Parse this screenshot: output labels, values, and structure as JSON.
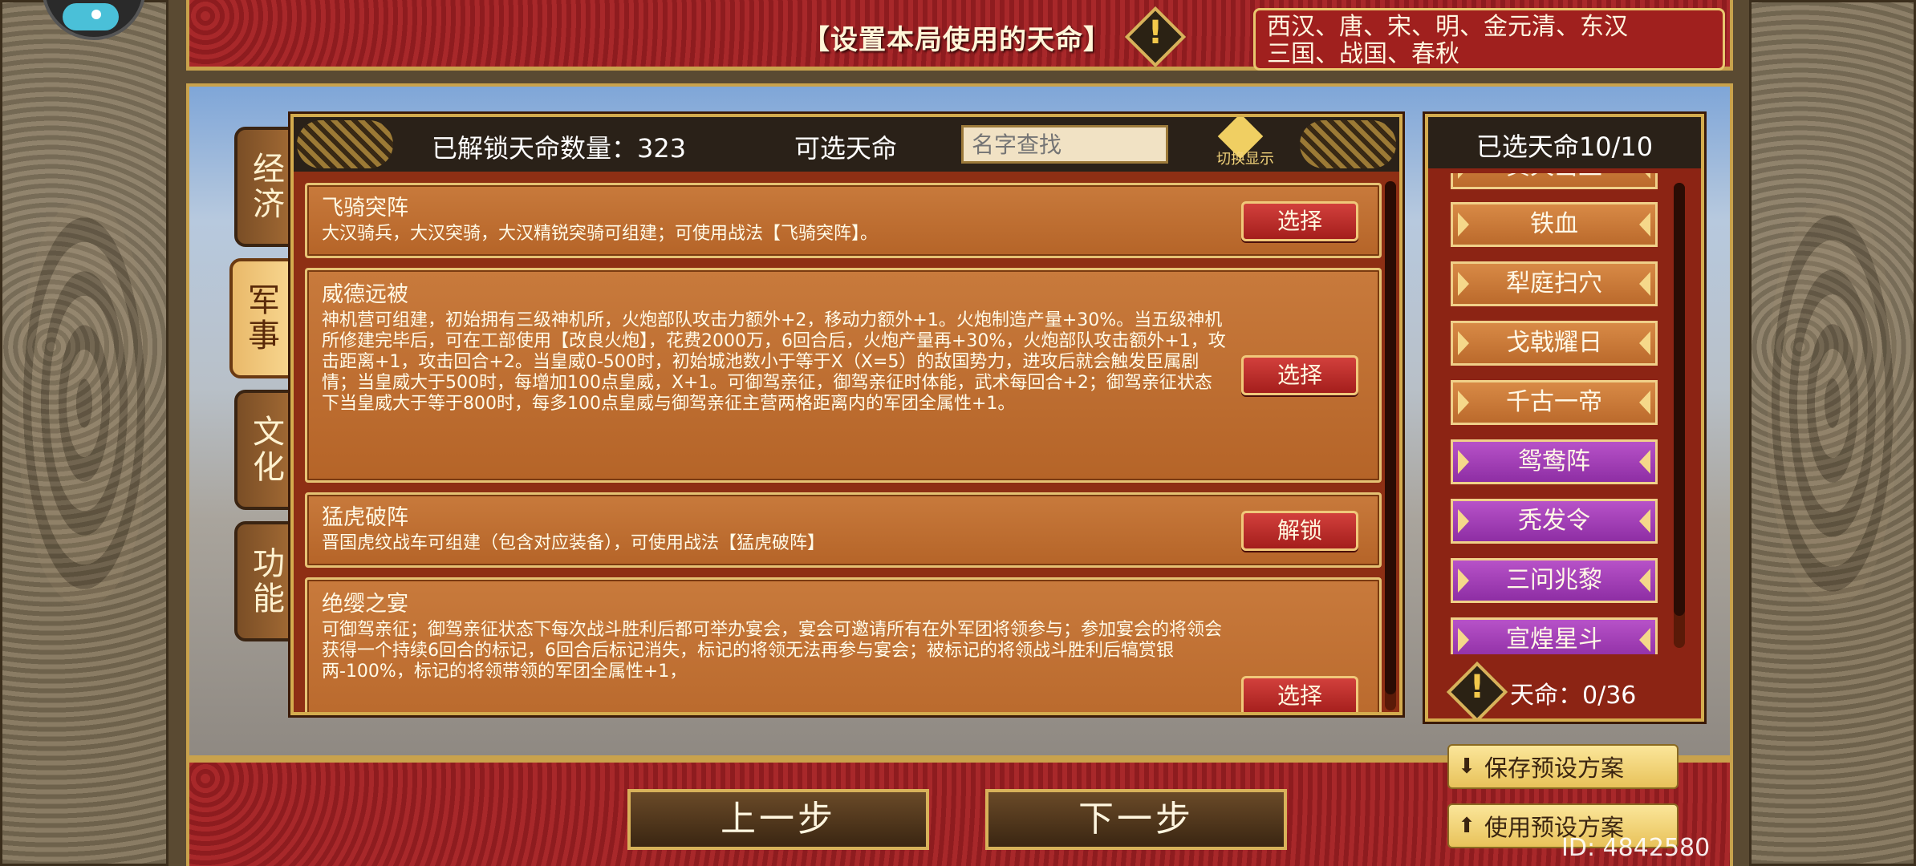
{
  "banner": {
    "title": "【设置本局使用的天命】",
    "warn_symbol": "!",
    "dynasties_line1": "西汉、唐、宋、明、金元清、东汉",
    "dynasties_line2": "三国、战国、春秋"
  },
  "tabs": [
    {
      "label": "经济",
      "active": false
    },
    {
      "label": "军事",
      "active": true
    },
    {
      "label": "文化",
      "active": false
    },
    {
      "label": "功能",
      "active": false
    }
  ],
  "list_panel": {
    "unlocked_label": "已解锁天命数量：323",
    "selectable_label": "可选天命",
    "search_placeholder": "名字查找",
    "toggle_label": "切换显示"
  },
  "cards": [
    {
      "title": "飞骑突阵",
      "desc": "大汉骑兵，大汉突骑，大汉精锐突骑可组建；可使用战法【飞骑突阵】。",
      "button": "选择"
    },
    {
      "title": "威德远被",
      "desc": "神机营可组建，初始拥有三级神机所，火炮部队攻击力额外+2，移动力额外+1。火炮制造产量+30%。当五级神机所修建完毕后，可在工部使用【改良火炮】，花费2000万，6回合后，火炮产量再+30%，火炮部队攻击额外+1，攻击距离+1，攻击回合+2。当皇威0-500时，初始城池数小于等于X（X=5）的敌国势力，进攻后就会触发臣属剧情；当皇威大于500时，每增加100点皇威，X+1。可御驾亲征，御驾亲征时体能，武术每回合+2；御驾亲征状态下当皇威大于等于800时，每多100点皇威与御驾亲征主营两格距离内的军团全属性+1。",
      "button": "选择"
    },
    {
      "title": "猛虎破阵",
      "desc": "晋国虎纹战车可组建（包含对应装备），可使用战法【猛虎破阵】",
      "button": "解锁"
    },
    {
      "title": "绝缨之宴",
      "desc": "可御驾亲征；御驾亲征状态下每次战斗胜利后都可举办宴会，宴会可邀请所有在外军团将领参与；参加宴会的将领会获得一个持续6回合的标记，6回合后标记消失，标记的将领无法再参与宴会；被标记的将领战斗胜利后犒赏银两-100%，标记的将领带领的军团全属性+1，",
      "button": "选择"
    }
  ],
  "selected_panel": {
    "title": "已选天命10/10",
    "items": [
      {
        "label": "黄天当立",
        "color": "orange"
      },
      {
        "label": "铁血",
        "color": "orange"
      },
      {
        "label": "犁庭扫穴",
        "color": "orange"
      },
      {
        "label": "戈戟耀日",
        "color": "orange"
      },
      {
        "label": "千古一帝",
        "color": "orange"
      },
      {
        "label": "鸳鸯阵",
        "color": "purple"
      },
      {
        "label": "秃发令",
        "color": "purple"
      },
      {
        "label": "三问兆黎",
        "color": "purple"
      },
      {
        "label": "宣煌星斗",
        "color": "purple"
      }
    ],
    "count_label": "天命：0/36"
  },
  "bottom": {
    "prev": "上一步",
    "next": "下一步",
    "save_preset": "保存预设方案",
    "use_preset": "使用预设方案",
    "id_label": "ID: 4842580"
  },
  "colors": {
    "accent_gold": "#d4ac4e",
    "banner_red": "#a8282a",
    "card_orange": "#c87a3c",
    "purple_item": "#b752c8"
  }
}
